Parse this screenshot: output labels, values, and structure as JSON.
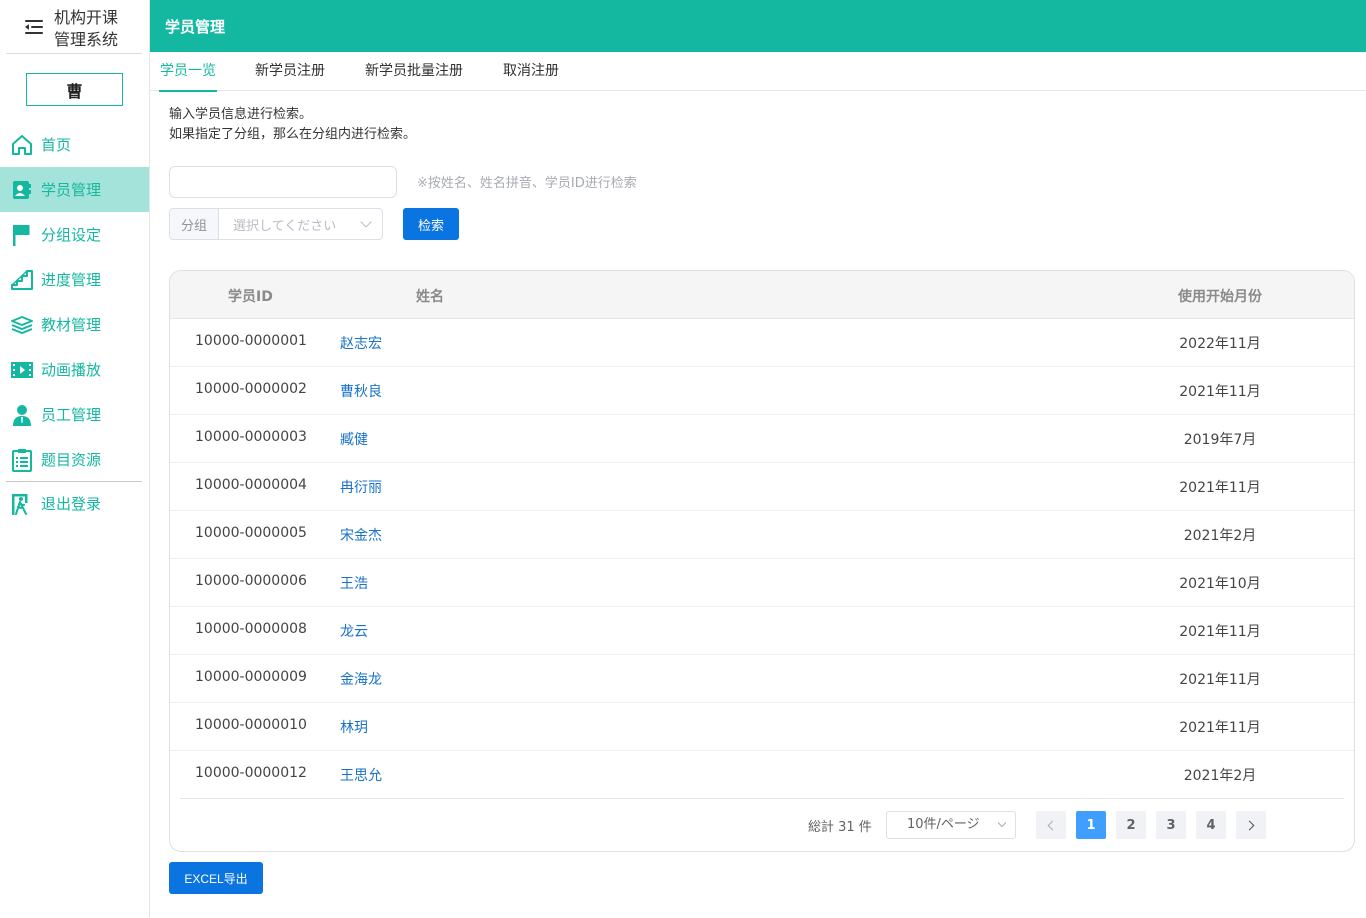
{
  "app": {
    "title_line1": "机构开课",
    "title_line2": "管理系统",
    "user_initial": "曹"
  },
  "sidebar": {
    "items": [
      {
        "label": "首页",
        "icon": "home-icon"
      },
      {
        "label": "学员管理",
        "icon": "student-card-icon",
        "active": true
      },
      {
        "label": "分组设定",
        "icon": "flag-icon"
      },
      {
        "label": "进度管理",
        "icon": "stairs-icon"
      },
      {
        "label": "教材管理",
        "icon": "books-icon"
      },
      {
        "label": "动画播放",
        "icon": "film-icon"
      },
      {
        "label": "员工管理",
        "icon": "staff-icon"
      },
      {
        "label": "题目资源",
        "icon": "checklist-icon"
      }
    ],
    "logout": {
      "label": "退出登录",
      "icon": "exit-icon"
    }
  },
  "header": {
    "title": "学员管理"
  },
  "tabs": [
    {
      "label": "学员一览",
      "active": true
    },
    {
      "label": "新学员注册"
    },
    {
      "label": "新学员批量注册"
    },
    {
      "label": "取消注册"
    }
  ],
  "hint": {
    "line1": "输入学员信息进行检索。",
    "line2": "如果指定了分组，那么在分组内进行检索。"
  },
  "search": {
    "value": "",
    "placeholder": "",
    "note": "※按姓名、姓名拼音、学员ID进行检索"
  },
  "group": {
    "label": "分组",
    "placeholder": "選択してください"
  },
  "search_button": "检索",
  "table": {
    "headers": {
      "id": "学员ID",
      "name": "姓名",
      "month": "使用开始月份"
    },
    "rows": [
      {
        "id": "10000-0000001",
        "name": "赵志宏",
        "month": "2022年11月"
      },
      {
        "id": "10000-0000002",
        "name": "曹秋良",
        "month": "2021年11月"
      },
      {
        "id": "10000-0000003",
        "name": "臧健",
        "month": "2019年7月"
      },
      {
        "id": "10000-0000004",
        "name": "冉衍丽",
        "month": "2021年11月"
      },
      {
        "id": "10000-0000005",
        "name": "宋金杰",
        "month": "2021年2月"
      },
      {
        "id": "10000-0000006",
        "name": "王浩",
        "month": "2021年10月"
      },
      {
        "id": "10000-0000008",
        "name": "龙云",
        "month": "2021年11月"
      },
      {
        "id": "10000-0000009",
        "name": "金海龙",
        "month": "2021年11月"
      },
      {
        "id": "10000-0000010",
        "name": "林玥",
        "month": "2021年11月"
      },
      {
        "id": "10000-0000012",
        "name": "王思允",
        "month": "2021年2月"
      }
    ]
  },
  "pagination": {
    "total": "総計 31 件",
    "page_size": "10件/ページ",
    "pages": [
      "1",
      "2",
      "3",
      "4"
    ],
    "current": "1"
  },
  "excel_button": "EXCEL导出",
  "colors": {
    "primary": "#14b8a0",
    "active_nav_bg": "#a4e3d9",
    "button_blue": "#0a74e0",
    "link_blue": "#1a73c8"
  }
}
